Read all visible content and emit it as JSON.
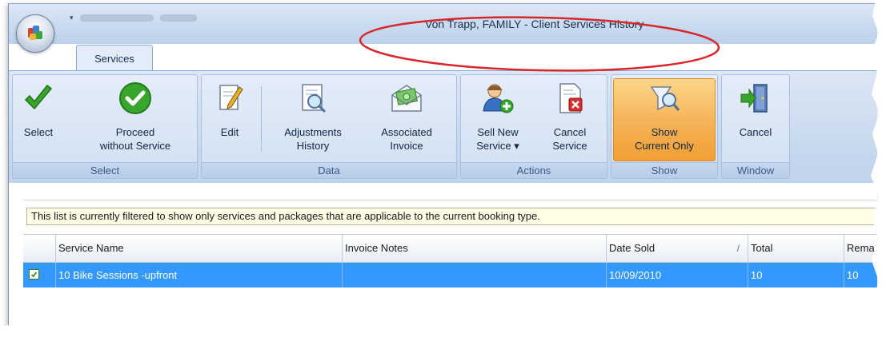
{
  "window": {
    "title": "Von Trapp, FAMILY - Client Services History"
  },
  "ribbon": {
    "tabs": [
      "Services"
    ],
    "groups": [
      {
        "label": "Select",
        "buttons": [
          {
            "label_line1": "Select",
            "label_line2": "",
            "icon": "green-checkmark-icon"
          },
          {
            "label_line1": "Proceed",
            "label_line2": "without Service",
            "icon": "check-circle-icon"
          }
        ]
      },
      {
        "label": "Data",
        "buttons": [
          {
            "label_line1": "Edit",
            "label_line2": "",
            "icon": "edit-document-icon"
          },
          {
            "label_line1": "Adjustments",
            "label_line2": "History",
            "icon": "magnify-document-icon"
          },
          {
            "label_line1": "Associated",
            "label_line2": "Invoice",
            "icon": "money-envelope-icon"
          }
        ]
      },
      {
        "label": "Actions",
        "buttons": [
          {
            "label_line1": "Sell New",
            "label_line2": "Service ▾",
            "icon": "user-add-icon"
          },
          {
            "label_line1": "Cancel",
            "label_line2": "Service",
            "icon": "cancel-document-icon"
          }
        ]
      },
      {
        "label": "Show",
        "buttons": [
          {
            "label_line1": "Show",
            "label_line2": "Current Only",
            "icon": "filter-magnifier-icon",
            "active": true
          }
        ]
      },
      {
        "label": "Window",
        "buttons": [
          {
            "label_line1": "Cancel",
            "label_line2": "",
            "icon": "exit-door-icon"
          }
        ]
      }
    ]
  },
  "filter_notice": "This list is currently filtered to show only services and packages that are applicable to the current booking type.",
  "grid": {
    "columns": [
      "Service Name",
      "Invoice Notes",
      "Date Sold",
      "Total",
      "Rema"
    ],
    "sort_indicator": "/",
    "rows": [
      {
        "service_name": "10 Bike Sessions -upfront",
        "invoice_notes": "",
        "date_sold": "10/09/2010",
        "total": "10",
        "remaining": "10",
        "selected": true
      }
    ]
  },
  "colors": {
    "ribbon_bg": "#c7d8ee",
    "active_button": "#f6b45a",
    "selected_row": "#3399ff",
    "callout_ellipse": "#d9262a"
  }
}
